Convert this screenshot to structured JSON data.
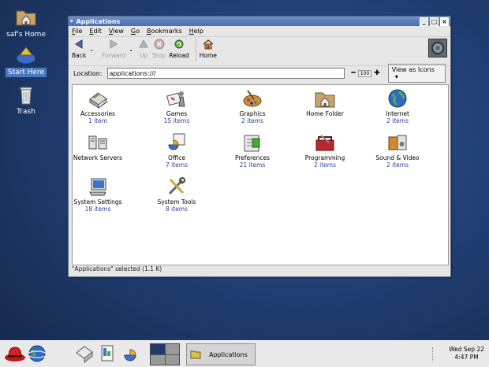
{
  "desktop": {
    "icons": [
      {
        "label": "saf's Home",
        "icon": "home-folder-icon"
      },
      {
        "label": "Start Here",
        "icon": "start-here-icon"
      },
      {
        "label": "Trash",
        "icon": "trash-icon"
      }
    ]
  },
  "window": {
    "title": "Applications",
    "menu": [
      "File",
      "Edit",
      "View",
      "Go",
      "Bookmarks",
      "Help"
    ],
    "toolbar": {
      "back": "Back",
      "forward": "Forward",
      "up": "Up",
      "stop": "Stop",
      "reload": "Reload",
      "home": "Home"
    },
    "location": {
      "label": "Location:",
      "value": "applications:///",
      "zoom": "100",
      "view_as": "View as Icons"
    },
    "items": [
      {
        "name": "Accessories",
        "count": "1 item",
        "icon": "accessories-icon"
      },
      {
        "name": "Games",
        "count": "15 items",
        "icon": "games-icon"
      },
      {
        "name": "Graphics",
        "count": "2 items",
        "icon": "graphics-icon"
      },
      {
        "name": "Home Folder",
        "count": "",
        "icon": "home-folder-icon"
      },
      {
        "name": "Internet",
        "count": "2 items",
        "icon": "internet-icon"
      },
      {
        "name": "Network Servers",
        "count": "",
        "icon": "network-servers-icon"
      },
      {
        "name": "Office",
        "count": "7 items",
        "icon": "office-icon"
      },
      {
        "name": "Preferences",
        "count": "21 items",
        "icon": "preferences-icon"
      },
      {
        "name": "Programming",
        "count": "2 items",
        "icon": "programming-icon"
      },
      {
        "name": "Sound & Video",
        "count": "2 items",
        "icon": "sound-video-icon"
      },
      {
        "name": "System Settings",
        "count": "18 items",
        "icon": "system-settings-icon"
      },
      {
        "name": "System Tools",
        "count": "8 items",
        "icon": "system-tools-icon"
      }
    ],
    "status": "\"Applications\" selected (1.1 K)"
  },
  "panel": {
    "task_label": "Applications",
    "clock_date": "Wed Sep 22",
    "clock_time": "4:47 PM"
  }
}
